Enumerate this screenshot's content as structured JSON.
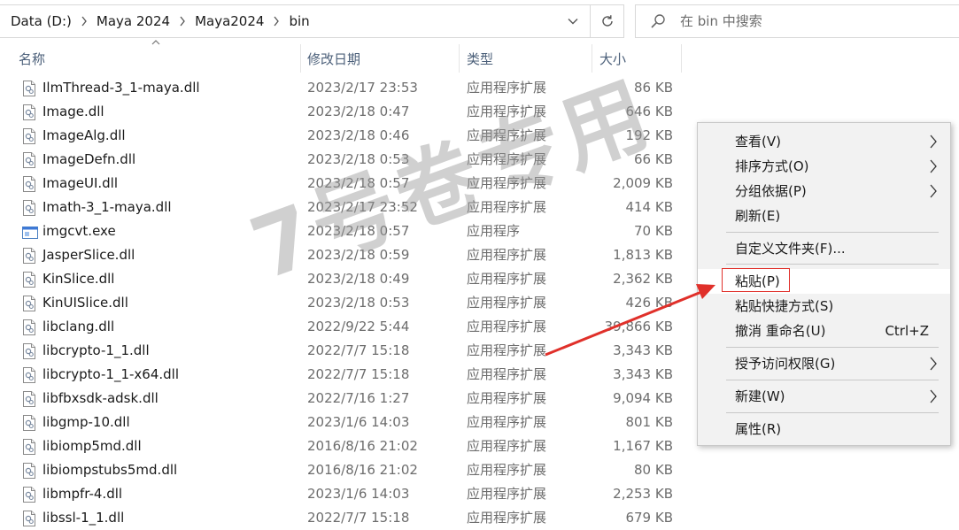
{
  "address": {
    "crumbs": [
      "Data (D:)",
      "Maya 2024",
      "Maya2024",
      "bin"
    ]
  },
  "search": {
    "placeholder": "在 bin 中搜索"
  },
  "columns": {
    "name": "名称",
    "date": "修改日期",
    "type": "类型",
    "size": "大小"
  },
  "files": [
    {
      "name": "IlmThread-3_1-maya.dll",
      "date": "2023/2/17 23:53",
      "type": "应用程序扩展",
      "size": "86 KB",
      "icon": "dll-file-icon"
    },
    {
      "name": "Image.dll",
      "date": "2023/2/18 0:47",
      "type": "应用程序扩展",
      "size": "646 KB",
      "icon": "dll-file-icon"
    },
    {
      "name": "ImageAlg.dll",
      "date": "2023/2/18 0:46",
      "type": "应用程序扩展",
      "size": "192 KB",
      "icon": "dll-file-icon"
    },
    {
      "name": "ImageDefn.dll",
      "date": "2023/2/18 0:53",
      "type": "应用程序扩展",
      "size": "66 KB",
      "icon": "dll-file-icon"
    },
    {
      "name": "ImageUI.dll",
      "date": "2023/2/18 0:57",
      "type": "应用程序扩展",
      "size": "2,009 KB",
      "icon": "dll-file-icon"
    },
    {
      "name": "Imath-3_1-maya.dll",
      "date": "2023/2/17 23:52",
      "type": "应用程序扩展",
      "size": "414 KB",
      "icon": "dll-file-icon"
    },
    {
      "name": "imgcvt.exe",
      "date": "2023/2/18 0:57",
      "type": "应用程序",
      "size": "70 KB",
      "icon": "exe-file-icon"
    },
    {
      "name": "JasperSlice.dll",
      "date": "2023/2/18 0:59",
      "type": "应用程序扩展",
      "size": "1,813 KB",
      "icon": "dll-file-icon"
    },
    {
      "name": "KinSlice.dll",
      "date": "2023/2/18 0:49",
      "type": "应用程序扩展",
      "size": "2,362 KB",
      "icon": "dll-file-icon"
    },
    {
      "name": "KinUISlice.dll",
      "date": "2023/2/18 0:53",
      "type": "应用程序扩展",
      "size": "426 KB",
      "icon": "dll-file-icon"
    },
    {
      "name": "libclang.dll",
      "date": "2022/9/22 5:44",
      "type": "应用程序扩展",
      "size": "39,866 KB",
      "icon": "dll-file-icon"
    },
    {
      "name": "libcrypto-1_1.dll",
      "date": "2022/7/7 15:18",
      "type": "应用程序扩展",
      "size": "3,343 KB",
      "icon": "dll-file-icon"
    },
    {
      "name": "libcrypto-1_1-x64.dll",
      "date": "2022/7/7 15:18",
      "type": "应用程序扩展",
      "size": "3,343 KB",
      "icon": "dll-file-icon"
    },
    {
      "name": "libfbxsdk-adsk.dll",
      "date": "2022/7/16 1:27",
      "type": "应用程序扩展",
      "size": "9,094 KB",
      "icon": "dll-file-icon"
    },
    {
      "name": "libgmp-10.dll",
      "date": "2023/1/6 14:03",
      "type": "应用程序扩展",
      "size": "801 KB",
      "icon": "dll-file-icon"
    },
    {
      "name": "libiomp5md.dll",
      "date": "2016/8/16 21:02",
      "type": "应用程序扩展",
      "size": "1,167 KB",
      "icon": "dll-file-icon"
    },
    {
      "name": "libiompstubs5md.dll",
      "date": "2016/8/16 21:02",
      "type": "应用程序扩展",
      "size": "80 KB",
      "icon": "dll-file-icon"
    },
    {
      "name": "libmpfr-4.dll",
      "date": "2023/1/6 14:03",
      "type": "应用程序扩展",
      "size": "2,253 KB",
      "icon": "dll-file-icon"
    },
    {
      "name": "libssl-1_1.dll",
      "date": "2022/7/7 15:18",
      "type": "应用程序扩展",
      "size": "679 KB",
      "icon": "dll-file-icon"
    }
  ],
  "watermark": "7号卷专用",
  "context_menu": {
    "view": "查看(V)",
    "sort": "排序方式(O)",
    "group": "分组依据(P)",
    "refresh": "刷新(E)",
    "customize": "自定义文件夹(F)...",
    "paste": "粘贴(P)",
    "paste_shortcut": "粘贴快捷方式(S)",
    "undo_rename": "撤消 重命名(U)",
    "undo_shortcut": "Ctrl+Z",
    "grant_access": "授予访问权限(G)",
    "new": "新建(W)",
    "properties": "属性(R)"
  },
  "colors": {
    "annotation_red": "#e0302a",
    "header_text": "#4c607a"
  }
}
